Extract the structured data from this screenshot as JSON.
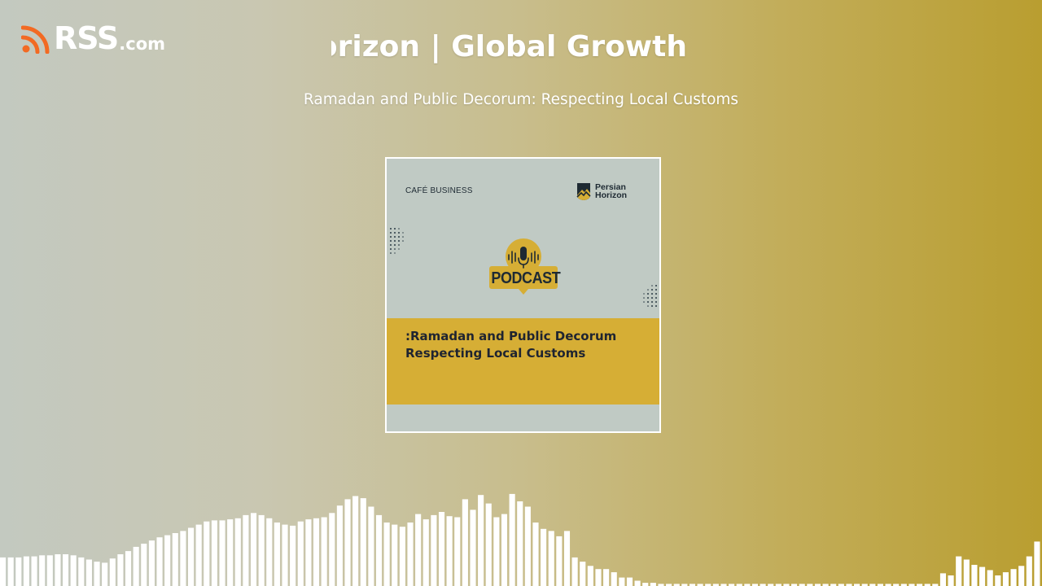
{
  "brand": {
    "name": "RSS",
    "suffix": ".com"
  },
  "header": {
    "show_title": "Persian Horizon | Global Growth",
    "episode_title": "Ramadan and Public Decorum: Respecting Local Customs"
  },
  "cover": {
    "series_label": "CAFÉ BUSINESS",
    "brand_line1": "Persian",
    "brand_line2": "Horizon",
    "podcast_label": "PODCAST",
    "headline_line1": ":Ramadan and Public Decorum",
    "headline_line2": "Respecting Local Customs"
  },
  "colors": {
    "rss_orange": "#f26a23",
    "cover_bg": "#c0cac4",
    "accent_yellow": "#d6ae35",
    "navy": "#1e2a33"
  },
  "waveform": {
    "levels": [
      0.27,
      0.27,
      0.27,
      0.28,
      0.28,
      0.29,
      0.29,
      0.3,
      0.3,
      0.29,
      0.27,
      0.25,
      0.23,
      0.22,
      0.26,
      0.3,
      0.33,
      0.37,
      0.4,
      0.43,
      0.46,
      0.48,
      0.5,
      0.52,
      0.55,
      0.58,
      0.61,
      0.62,
      0.62,
      0.63,
      0.64,
      0.67,
      0.69,
      0.67,
      0.64,
      0.6,
      0.58,
      0.57,
      0.61,
      0.63,
      0.64,
      0.65,
      0.69,
      0.76,
      0.82,
      0.85,
      0.83,
      0.75,
      0.67,
      0.6,
      0.58,
      0.56,
      0.6,
      0.68,
      0.63,
      0.67,
      0.7,
      0.66,
      0.65,
      0.82,
      0.72,
      0.86,
      0.78,
      0.65,
      0.68,
      0.87,
      0.8,
      0.75,
      0.6,
      0.54,
      0.52,
      0.47,
      0.52,
      0.27,
      0.23,
      0.19,
      0.16,
      0.16,
      0.13,
      0.08,
      0.08,
      0.05,
      0.03,
      0.03,
      0.02,
      0.02,
      0.02,
      0.02,
      0.02,
      0.02,
      0.02,
      0.02,
      0.02,
      0.02,
      0.02,
      0.02,
      0.02,
      0.02,
      0.02,
      0.02,
      0.02,
      0.02,
      0.02,
      0.02,
      0.02,
      0.02,
      0.02,
      0.02,
      0.02,
      0.02,
      0.02,
      0.02,
      0.02,
      0.02,
      0.02,
      0.02,
      0.02,
      0.02,
      0.02,
      0.02,
      0.12,
      0.1,
      0.28,
      0.25,
      0.2,
      0.18,
      0.15,
      0.1,
      0.13,
      0.16,
      0.19,
      0.28,
      0.42
    ]
  }
}
